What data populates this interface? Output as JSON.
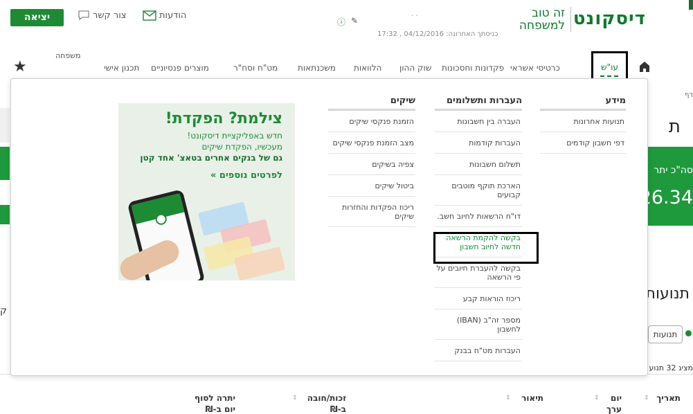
{
  "header": {
    "exit_label": "יציאה",
    "messages_label": "הודעות",
    "contact_label": "צור קשר",
    "last_login_label": "כניסתך האחרונה:",
    "last_login_value": "04/12/2016 , 17:32",
    "dots": "· ·",
    "logo_text": "דיסקונט",
    "tagline_line1": "זה טוב",
    "tagline_line2": "למשפחה"
  },
  "nav": {
    "active_label": "עו\"ש",
    "items": [
      "כרטיסי אשראי",
      "פקדונות וחסכונות",
      "שוק ההון",
      "הלוואות",
      "משכנתאות",
      "מט\"ח וסח\"ר",
      "מוצרים פנסיוניים",
      "תכנון אישי"
    ],
    "family_label": "משפחה"
  },
  "background": {
    "dafim": "דף",
    "heading": "ת",
    "panel_label": "סה\"כ יתר",
    "panel_amount": "26.34",
    "tnuot_heading": "תנועות",
    "pill_label": "תנועות",
    "count_text": "מציג 32 תנוע",
    "left_letter": "ק"
  },
  "table_headers": {
    "date": "תאריך",
    "day": "יום ערך",
    "description": "תיאור",
    "credit_debit": "זכות/חובה ב-₪",
    "balance": "יתרה לסוף יום ב-₪"
  },
  "menu": {
    "columns": [
      {
        "title": "מידע",
        "items": [
          "תנועות אחרונות",
          "דפי חשבון קודמים"
        ]
      },
      {
        "title": "העברות ותשלומים",
        "items": [
          "העברה בין חשבונות",
          "העברות קודמות",
          "תשלום חשבונות",
          "הארכת תוקף מוטבים קבועים",
          "דו\"ח הרשאות לחיוב חשב.",
          "בקשה להקמת הרשאה חדשה לחיוב חשבון",
          "בקשה להעברת חיובים על פי הרשאה",
          "ריכוז הוראות קבע",
          "מספר זה\"ב (IBAN) לחשבון",
          "העברות מט\"ח בבנק"
        ]
      },
      {
        "title": "שיקים",
        "items": [
          "הזמנת פנקסי שיקים",
          "מצב הזמנת פנקסי שיקים",
          "צפיה בשיקים",
          "ביטול שיקים",
          "ריכוז הפקדות והחזרות שיקים"
        ]
      }
    ],
    "highlighted_item": "בקשה להקמת הרשאה חדשה לחיוב חשבון"
  },
  "promo": {
    "title": "צילמת? הפקדת!",
    "line1": "חדש באפליקציית דיסקונט!",
    "line2": "מעכשיו, הפקדת שיקים",
    "line3": "גם של בנקים אחרים בטאצ' אחד קטן",
    "cta": "לפרטים נוספים »"
  },
  "colors": {
    "brand_green": "#1d8b34",
    "link_green": "#0e8a2e"
  }
}
